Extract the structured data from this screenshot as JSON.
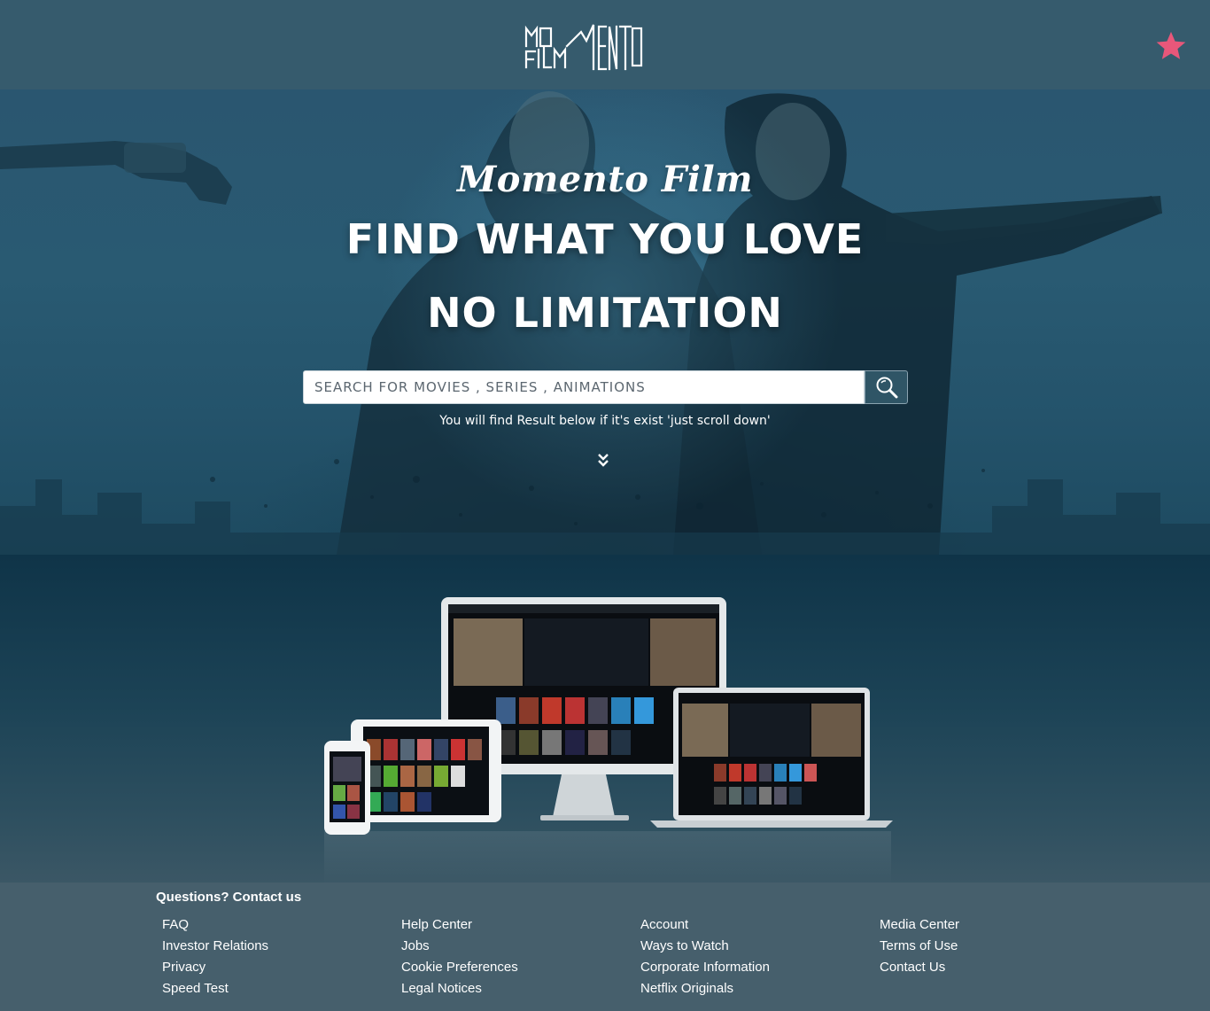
{
  "header": {
    "logo_text": "MOMENTO FILM"
  },
  "hero": {
    "brand": "Momento Film",
    "headline_1": "FIND WHAT YOU LOVE",
    "headline_2": "NO LIMITATION",
    "search": {
      "placeholder": "SEARCH FOR MOVIES , SERIES , ANIMATIONS",
      "value": ""
    },
    "hint": "You will find Result below if it's exist 'just scroll down'"
  },
  "footer": {
    "title": "Questions? Contact us",
    "columns": [
      [
        "FAQ",
        "Investor Relations",
        "Privacy",
        "Speed Test"
      ],
      [
        "Help Center",
        "Jobs",
        "Cookie Preferences",
        "Legal Notices"
      ],
      [
        "Account",
        "Ways to Watch",
        "Corporate Information",
        "Netflix Originals"
      ],
      [
        "Media Center",
        "Terms of Use",
        "Contact Us"
      ]
    ]
  },
  "colors": {
    "header_bg": "#365b6d",
    "star": "#e8577a",
    "footer_bg": "#465f6c"
  },
  "icons": [
    "star-icon",
    "search-icon",
    "double-chevron-down-icon"
  ]
}
